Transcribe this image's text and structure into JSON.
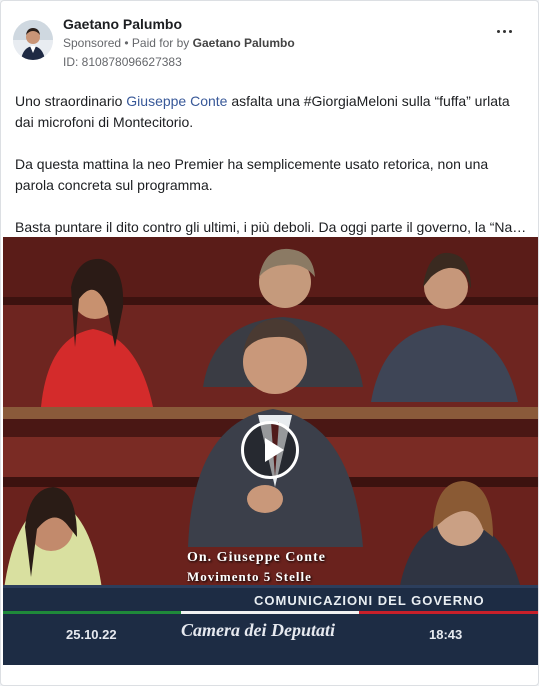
{
  "post": {
    "author": "Gaetano Palumbo",
    "sponsored": "Sponsored",
    "paid_for_prefix": "• Paid for by",
    "paid_for_by": "Gaetano Palumbo",
    "ad_id": "ID: 810878096627383",
    "menu_icon": "more-horizontal-icon"
  },
  "text": {
    "p1_a": "Uno straordinario",
    "p1_link": "Giuseppe Conte",
    "p1_b": "asfalta una #GiorgiaMeloni sulla “fuffa” urlata dai microfoni di Montecitorio.",
    "p2": "Da questa mattina la neo Premier ha semplicemente usato retorica, non una parola concreta sul programma.",
    "p3": "Basta puntare il dito contro gli ultimi, i più deboli. Da oggi parte il governo, la “Nav…"
  },
  "video": {
    "play_icon": "play-icon",
    "caption_name": "On. Giuseppe Conte",
    "caption_party": "Movimento 5 Stelle",
    "ticker": "COMUNICAZIONI DEL GOVERNO",
    "date": "25.10.22",
    "channel": "Camera dei Deputati",
    "time": "18:43"
  }
}
